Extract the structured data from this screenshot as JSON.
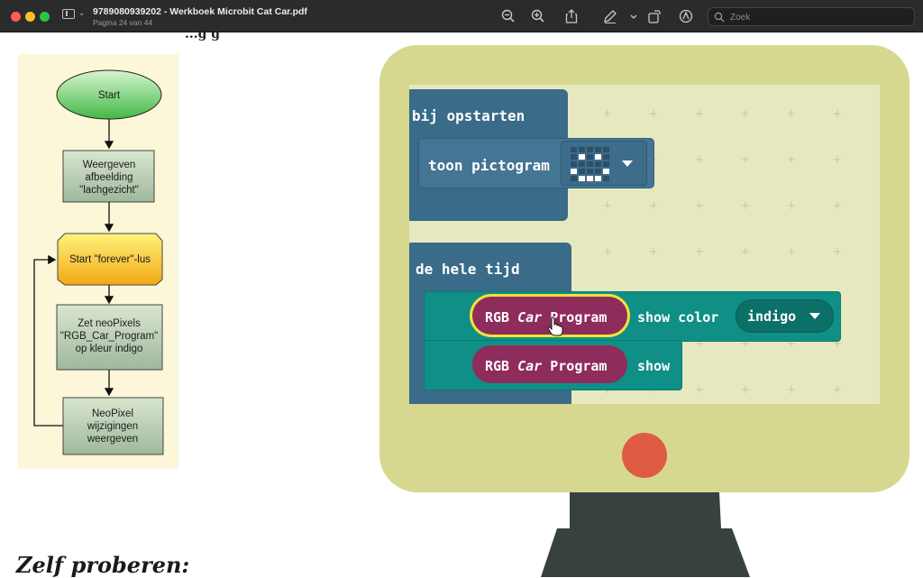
{
  "window": {
    "doc_title": "9789080939202 - Werkboek Microbit Cat Car.pdf",
    "page_indicator": "Pagina 24 van 44"
  },
  "toolbar": {
    "search_placeholder": "Zoek",
    "icons": [
      "zoom-out-icon",
      "zoom-in-icon",
      "share-icon",
      "markup-pen-icon",
      "rotate-icon",
      "annotate-icon",
      "search-icon"
    ]
  },
  "page": {
    "partial_heading": "...g g"
  },
  "flowchart": {
    "start": "Start",
    "step1": [
      "Weergeven",
      "afbeelding",
      "\"lachgezicht\""
    ],
    "loop": "Start \"forever\"-lus",
    "step2": [
      "Zet neoPixels",
      "\"RGB_Car_Program\"",
      "op kleur indigo"
    ],
    "step3": [
      "NeoPixel",
      "wijzigingen",
      "weergeven"
    ]
  },
  "code": {
    "on_start_label": "bij opstarten",
    "show_icon_label": "toon pictogram",
    "forever_label": "de hele tijd",
    "pill1": {
      "pre": "RGB ",
      "mid": "Car",
      "post": " Program"
    },
    "show_color_label": "show color",
    "color_value": "indigo",
    "pill2": {
      "pre": "RGB ",
      "mid": "Car",
      "post": " Program"
    },
    "show_label": "show"
  },
  "colors": {
    "accent_yellow": "#f2e23a",
    "block_blue": "#3a6b88",
    "block_teal": "#0f8f86",
    "pill_magenta": "#8e2c5c",
    "power_red": "#e05b44"
  },
  "footer": {
    "heading": "Zelf proberen:"
  }
}
